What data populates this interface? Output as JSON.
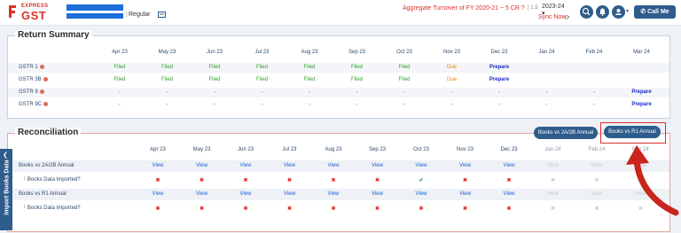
{
  "header": {
    "logo_small": "EXPRESS",
    "logo_big": "GST",
    "plan": "Regular",
    "separator": "|",
    "aggregate_text": "Aggregate Turnover of FY 2020-21 ~ 5 CR ?",
    "aggregate_extra": "| 1.5",
    "fy_select": "2023-24",
    "sync_text": "Sync Now",
    "call_me": "Call Me"
  },
  "return_summary": {
    "title": "Return Summary",
    "months": [
      "Apr 23",
      "May 23",
      "Jun 23",
      "Jul 23",
      "Aug 23",
      "Sep 23",
      "Oct 23",
      "Nov 23",
      "Dec 23",
      "Jan 24",
      "Feb 24",
      "Mar 24"
    ],
    "rows": [
      {
        "label": "GSTR 1",
        "cells": [
          "Filed",
          "Filed",
          "Filed",
          "Filed",
          "Filed",
          "Filed",
          "Filed",
          "Due",
          "Prepare",
          "",
          "",
          ""
        ]
      },
      {
        "label": "GSTR 3B",
        "cells": [
          "Filed",
          "Filed",
          "Filed",
          "Filed",
          "Filed",
          "Filed",
          "Filed",
          "Due",
          "Prepare",
          "",
          "",
          ""
        ]
      },
      {
        "label": "GSTR 9",
        "cells": [
          "-",
          "-",
          "-",
          "-",
          "-",
          "-",
          "-",
          "-",
          "-",
          "-",
          "-",
          "Prepare"
        ]
      },
      {
        "label": "GSTR 9C",
        "cells": [
          "-",
          "-",
          "-",
          "-",
          "-",
          "-",
          "-",
          "-",
          "-",
          "-",
          "-",
          "Prepare"
        ]
      }
    ]
  },
  "reconciliation": {
    "title": "Reconciliation",
    "buttons": {
      "books_2a2b": "Books vs 2A/2B Annual",
      "books_r1": "Books vs R1 Annual"
    },
    "months": [
      "Apr 23",
      "May 23",
      "Jun 23",
      "Jul 23",
      "Aug 23",
      "Sep 23",
      "Oct 23",
      "Nov 23",
      "Dec 23",
      "Jan 24",
      "Feb 24",
      "Mar 24"
    ],
    "rows": [
      {
        "label": "Books vs 2A/2B Annual",
        "sub": false,
        "cells": [
          "View",
          "View",
          "View",
          "View",
          "View",
          "View",
          "View",
          "View",
          "View",
          "View",
          "View",
          "View"
        ]
      },
      {
        "label": "Books Data Imported?",
        "sub": true,
        "cells": [
          "x",
          "x",
          "x",
          "x",
          "x",
          "x",
          "check",
          "x",
          "x",
          "x",
          "x",
          "x"
        ]
      },
      {
        "label": "Books vs R1 Annual",
        "sub": false,
        "cells": [
          "View",
          "View",
          "View",
          "View",
          "View",
          "View",
          "View",
          "View",
          "View",
          "View",
          "View",
          "View"
        ]
      },
      {
        "label": "Books Data Imported?",
        "sub": true,
        "cells": [
          "x",
          "x",
          "x",
          "x",
          "x",
          "x",
          "x",
          "x",
          "x",
          "x",
          "x",
          "x"
        ]
      }
    ]
  },
  "side_tab": {
    "label": "Import Books Data"
  },
  "colors": {
    "brand_red": "#d9312b",
    "nav_blue": "#2e5d8c",
    "filed_green": "#33a02c",
    "due_orange": "#e8870f",
    "prepare_blue": "#1a28c9"
  }
}
